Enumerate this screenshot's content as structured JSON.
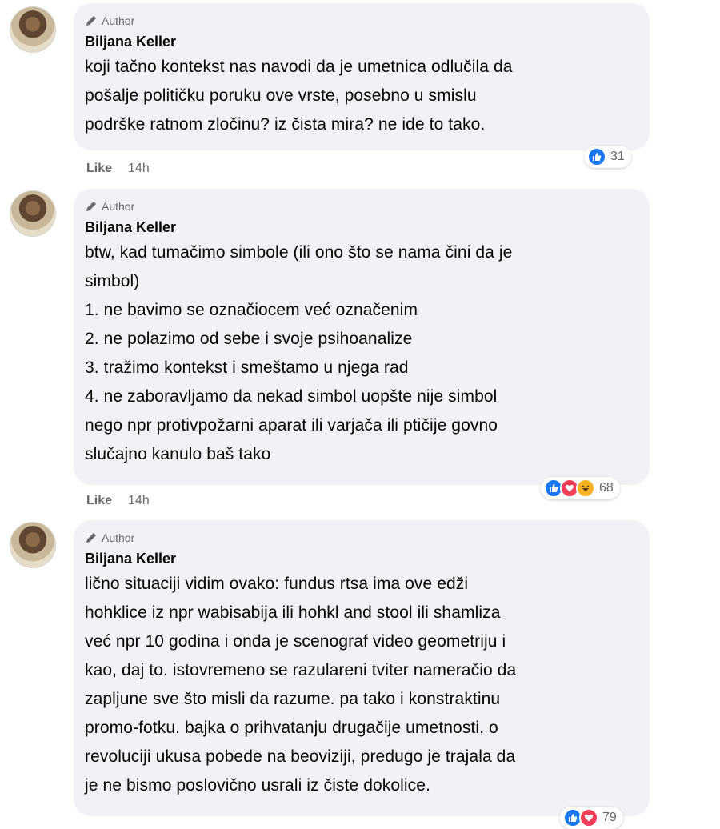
{
  "comments": [
    {
      "badge": "Author",
      "name": "Biljana Keller",
      "text": "koji tačno kontekst nas navodi da je umetnica odlučila da\npošalje političku poruku ove vrste, posebno u smislu\npodrške ratnom zločinu? iz čista mira? ne ide to tako.",
      "reactions": [
        "like"
      ],
      "reaction_count": "31",
      "like_label": "Like",
      "time": "14h"
    },
    {
      "badge": "Author",
      "name": "Biljana Keller",
      "text": "btw, kad tumačimo simbole (ili ono što se nama čini da je\nsimbol)\n1. ne bavimo se označiocem već označenim\n2. ne polazimo od sebe i svoje psihoanalize\n3. tražimo kontekst i smeštamo u njega rad\n4. ne zaboravljamo da nekad simbol uopšte nije simbol\nnego npr protivpožarni aparat ili varjača ili ptičije govno\nslučajno kanulo baš tako",
      "reactions": [
        "like",
        "love",
        "haha"
      ],
      "reaction_count": "68",
      "like_label": "Like",
      "time": "14h"
    },
    {
      "badge": "Author",
      "name": "Biljana Keller",
      "text": "lično situaciji vidim ovako: fundus rtsa ima ove edži\nhohklice iz npr wabisabija ili hohkl and stool ili shamliza\nveć npr 10 godina i onda je scenograf video geometriju i\nkao, daj to. istovremeno se razulareni tviter nameračio da\nzapljune sve što misli da razume. pa tako i konstraktinu\npromo-fotku. bajka o prihvatanju drugačije umetnosti, o\nrevoluciji ukusa pobede na beoviziji, predugo je trajala da\nje ne bismo poslovično usrali iz čiste dokolice.",
      "reactions": [
        "like",
        "love"
      ],
      "reaction_count": "79"
    }
  ],
  "colors": {
    "bubble": "#f0f2f5",
    "like": "#1877f2",
    "love": "#f33e58",
    "haha": "#f7b125",
    "secondary_text": "#65676b"
  }
}
